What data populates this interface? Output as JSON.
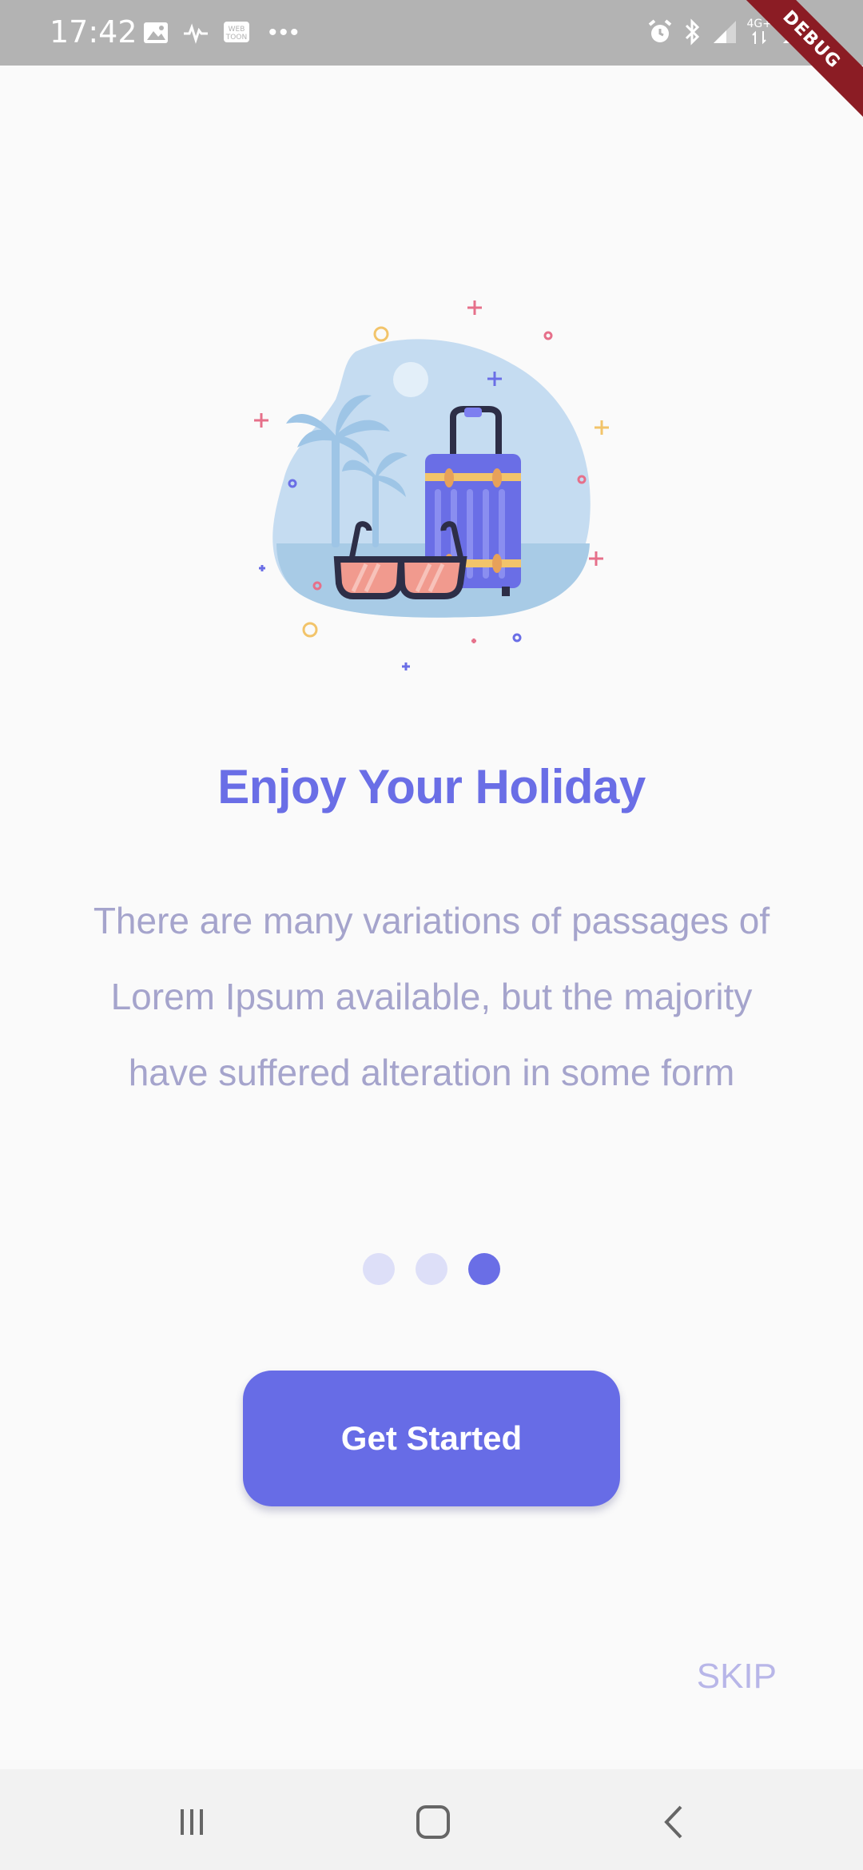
{
  "status_bar": {
    "time": "17:42",
    "left_icons": [
      "image-icon",
      "activity-icon",
      "webtoon-icon",
      "more-dots"
    ],
    "network_label": "4G+",
    "right_icons": [
      "alarm-icon",
      "bluetooth-icon",
      "signal-icon",
      "network-icon",
      "signal-icon-2"
    ],
    "debug_label": "DEBUG"
  },
  "onboarding": {
    "title": "Enjoy Your Holiday",
    "description": "There are many variations of passages of Lorem Ipsum available, but the majority have suffered alteration in some form",
    "pages": 3,
    "active_page_index": 2,
    "cta_label": "Get Started",
    "skip_label": "SKIP"
  },
  "colors": {
    "accent": "#6a6ee6",
    "text_muted": "#a5a4cc",
    "dot_inactive": "#dddff8",
    "background": "#fafafa"
  },
  "nav_bar": {
    "buttons": [
      "recent-apps",
      "home",
      "back"
    ]
  }
}
